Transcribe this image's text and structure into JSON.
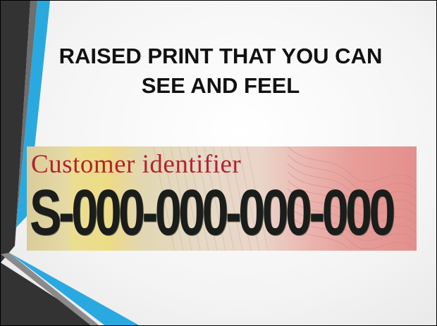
{
  "slide": {
    "title_line1": "RAISED PRINT THAT YOU CAN",
    "title_line2": "SEE AND FEEL"
  },
  "card": {
    "label": "Customer identifier",
    "number": "S-000-000-000-000"
  },
  "colors": {
    "accent_blue": "#29a8e0",
    "accent_dark": "#2e2e2e",
    "label_red": "#b3232e",
    "number_ink": "#1a1d1a"
  }
}
